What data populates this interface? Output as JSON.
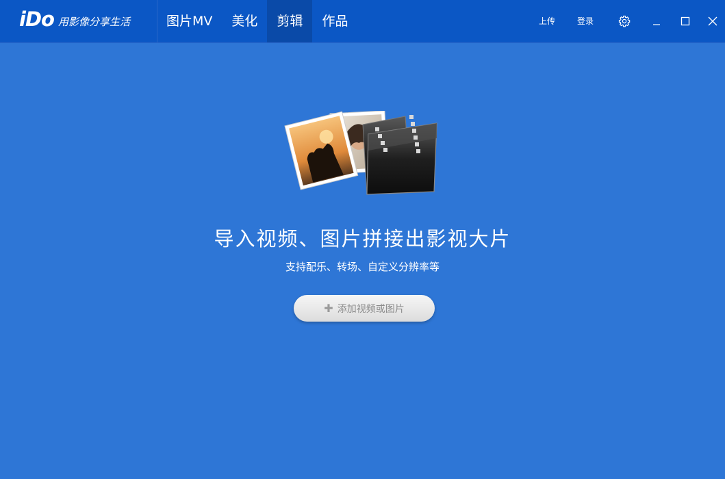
{
  "app": {
    "logo_text": "iDo",
    "slogan": "用影像分享生活"
  },
  "tabs": [
    {
      "label": "图片MV"
    },
    {
      "label": "美化"
    },
    {
      "label": "剪辑",
      "active": true
    },
    {
      "label": "作品"
    }
  ],
  "header_actions": {
    "upload_label": "上传",
    "login_label": "登录",
    "settings_icon": "gear-icon",
    "minimize_icon": "minimize-icon",
    "maximize_icon": "maximize-icon",
    "close_icon": "close-icon"
  },
  "main": {
    "headline": "导入视频、图片拼接出影视大片",
    "subline": "支持配乐、转场、自定义分辨率等",
    "add_button_label": "添加视频或图片",
    "add_button_icon": "plus-icon"
  },
  "colors": {
    "titlebar": "#0b57c5",
    "active_tab": "#0a4aa8",
    "background": "#2e76d6"
  }
}
